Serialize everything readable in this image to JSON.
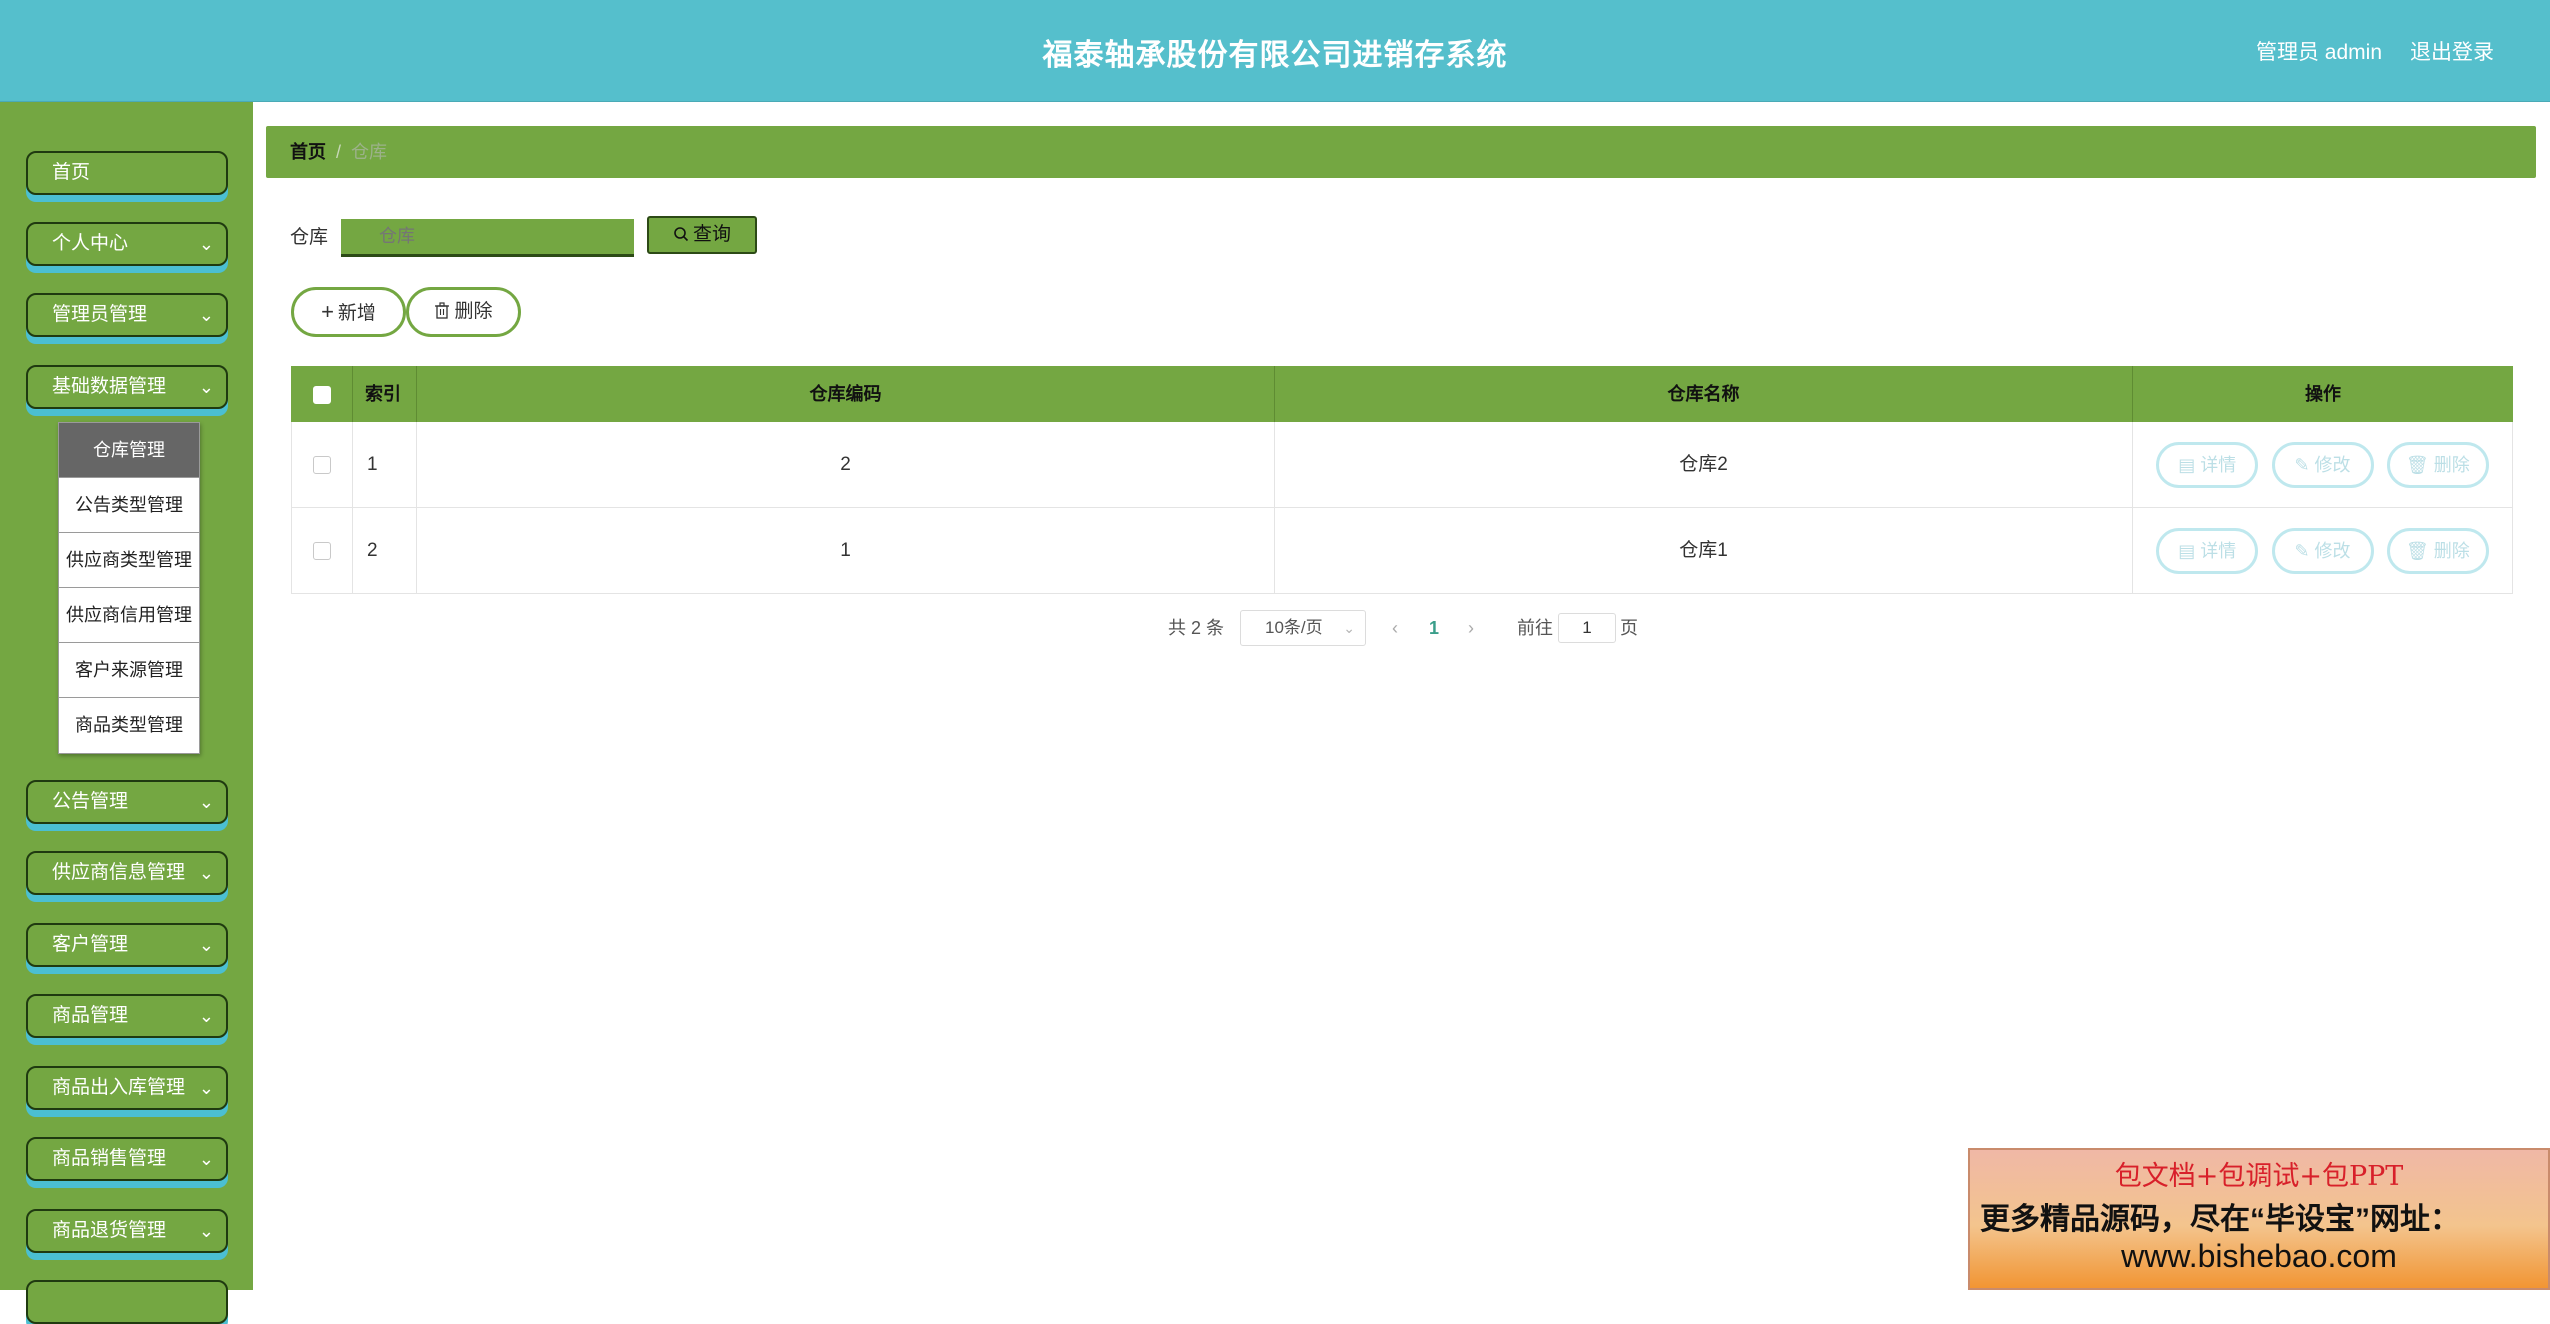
{
  "header": {
    "title": "福泰轴承股份有限公司进销存系统",
    "user": "管理员 admin",
    "logout": "退出登录"
  },
  "sidebar": {
    "items": [
      {
        "label": "首页",
        "has_chevron": false
      },
      {
        "label": "个人中心",
        "has_chevron": true
      },
      {
        "label": "管理员管理",
        "has_chevron": true
      },
      {
        "label": "基础数据管理",
        "has_chevron": true
      },
      {
        "label": "公告管理",
        "has_chevron": true
      },
      {
        "label": "供应商信息管理",
        "has_chevron": true
      },
      {
        "label": "客户管理",
        "has_chevron": true
      },
      {
        "label": "商品管理",
        "has_chevron": true
      },
      {
        "label": "商品出入库管理",
        "has_chevron": true
      },
      {
        "label": "商品销售管理",
        "has_chevron": true
      },
      {
        "label": "商品退货管理",
        "has_chevron": true
      }
    ],
    "submenu": [
      {
        "label": "仓库管理",
        "active": true
      },
      {
        "label": "公告类型管理",
        "active": false
      },
      {
        "label": "供应商类型管理",
        "active": false
      },
      {
        "label": "供应商信用管理",
        "active": false
      },
      {
        "label": "客户来源管理",
        "active": false
      },
      {
        "label": "商品类型管理",
        "active": false
      }
    ],
    "chevron_glyph": "⌄"
  },
  "breadcrumb": {
    "home": "首页",
    "separator": "/",
    "current": "仓库"
  },
  "search": {
    "label": "仓库",
    "placeholder": "仓库",
    "button": "查询",
    "button_icon": "search-icon"
  },
  "actions": {
    "add": "新增",
    "add_icon": "plus-icon",
    "delete": "删除",
    "delete_icon": "trash-icon"
  },
  "table": {
    "columns": [
      "索引",
      "仓库编码",
      "仓库名称",
      "操作"
    ],
    "rows": [
      {
        "index": "1",
        "code": "2",
        "name": "仓库2"
      },
      {
        "index": "2",
        "code": "1",
        "name": "仓库1"
      }
    ],
    "row_actions": {
      "detail": "详情",
      "edit": "修改",
      "delete": "删除"
    }
  },
  "pagination": {
    "total": "共 2 条",
    "page_size": "10条/页",
    "prev": "‹",
    "current_page": "1",
    "next": "›",
    "goto_label": "前往",
    "goto_value": "1",
    "page_unit": "页"
  },
  "ad": {
    "line1": "包文档+包调试+包PPT",
    "line2": "更多精品源码，尽在“毕设宝”网址：",
    "line3": "www.bishebao.com"
  },
  "colors": {
    "header": "#55bfcc",
    "sidebar": "#74a742",
    "accent_green": "#74a742",
    "active_submenu": "#666666",
    "button_shadow": "#4bbfd2"
  }
}
